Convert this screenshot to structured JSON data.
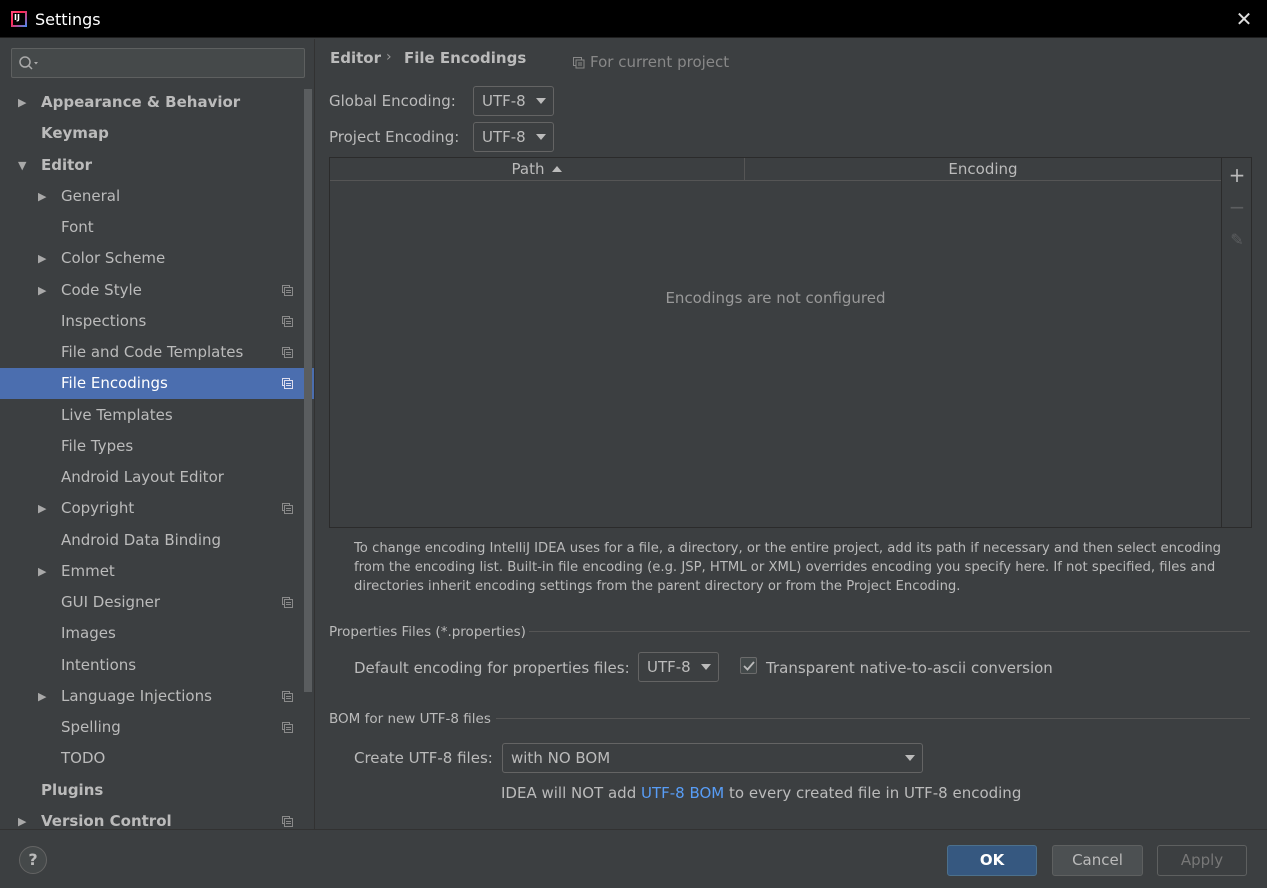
{
  "window": {
    "title": "Settings",
    "close_symbol": "✕"
  },
  "sidebar": {
    "search_placeholder": "",
    "items": [
      {
        "label": "Appearance & Behavior",
        "level": 0,
        "arrow": "▶",
        "bold": true,
        "project_icon": false
      },
      {
        "label": "Keymap",
        "level": 0,
        "arrow": "",
        "bold": true,
        "project_icon": false
      },
      {
        "label": "Editor",
        "level": 0,
        "arrow": "▼",
        "bold": true,
        "project_icon": false
      },
      {
        "label": "General",
        "level": 1,
        "arrow": "▶",
        "project_icon": false
      },
      {
        "label": "Font",
        "level": 1,
        "arrow": "",
        "project_icon": false
      },
      {
        "label": "Color Scheme",
        "level": 1,
        "arrow": "▶",
        "project_icon": false
      },
      {
        "label": "Code Style",
        "level": 1,
        "arrow": "▶",
        "project_icon": true
      },
      {
        "label": "Inspections",
        "level": 1,
        "arrow": "",
        "project_icon": true
      },
      {
        "label": "File and Code Templates",
        "level": 1,
        "arrow": "",
        "project_icon": true
      },
      {
        "label": "File Encodings",
        "level": 1,
        "arrow": "",
        "project_icon": true,
        "selected": true
      },
      {
        "label": "Live Templates",
        "level": 1,
        "arrow": "",
        "project_icon": false
      },
      {
        "label": "File Types",
        "level": 1,
        "arrow": "",
        "project_icon": false
      },
      {
        "label": "Android Layout Editor",
        "level": 1,
        "arrow": "",
        "project_icon": false
      },
      {
        "label": "Copyright",
        "level": 1,
        "arrow": "▶",
        "project_icon": true
      },
      {
        "label": "Android Data Binding",
        "level": 1,
        "arrow": "",
        "project_icon": false
      },
      {
        "label": "Emmet",
        "level": 1,
        "arrow": "▶",
        "project_icon": false
      },
      {
        "label": "GUI Designer",
        "level": 1,
        "arrow": "",
        "project_icon": true
      },
      {
        "label": "Images",
        "level": 1,
        "arrow": "",
        "project_icon": false
      },
      {
        "label": "Intentions",
        "level": 1,
        "arrow": "",
        "project_icon": false
      },
      {
        "label": "Language Injections",
        "level": 1,
        "arrow": "▶",
        "project_icon": true
      },
      {
        "label": "Spelling",
        "level": 1,
        "arrow": "",
        "project_icon": true
      },
      {
        "label": "TODO",
        "level": 1,
        "arrow": "",
        "project_icon": false
      },
      {
        "label": "Plugins",
        "level": 0,
        "arrow": "",
        "bold": true,
        "project_icon": false
      },
      {
        "label": "Version Control",
        "level": 0,
        "arrow": "▶",
        "bold": true,
        "project_icon": true
      }
    ]
  },
  "main": {
    "breadcrumb": {
      "parent": "Editor",
      "separator": "›",
      "current": "File Encodings"
    },
    "scope_note": "For current project",
    "global_encoding": {
      "label": "Global Encoding:",
      "value": "UTF-8"
    },
    "project_encoding": {
      "label": "Project Encoding:",
      "value": "UTF-8"
    },
    "table": {
      "columns": [
        "Path",
        "Encoding"
      ],
      "empty_message": "Encodings are not configured",
      "tools": {
        "add": "+",
        "remove": "−",
        "edit": "✎"
      }
    },
    "help_text": "To change encoding IntelliJ IDEA uses for a file, a directory, or the entire project, add its path if necessary and then select encoding from the encoding list. Built-in file encoding (e.g. JSP, HTML or XML) overrides encoding you specify here. If not specified, files and directories inherit encoding settings from the parent directory or from the Project Encoding.",
    "properties": {
      "section_title": "Properties Files (*.properties)",
      "default_label": "Default encoding for properties files:",
      "default_value": "UTF-8",
      "transparent_label": "Transparent native-to-ascii conversion",
      "transparent_checked": true
    },
    "bom": {
      "section_title": "BOM for new UTF-8 files",
      "create_label": "Create UTF-8 files:",
      "create_value": "with NO BOM",
      "note_prefix": "IDEA will NOT add ",
      "note_link": "UTF-8 BOM",
      "note_suffix": " to every created file in UTF-8 encoding"
    }
  },
  "footer": {
    "help": "?",
    "ok": "OK",
    "cancel": "Cancel",
    "apply": "Apply"
  },
  "colors": {
    "background": "#3c3f41",
    "selection": "#4b6eaf",
    "link": "#589df6",
    "primary_button": "#365880"
  }
}
